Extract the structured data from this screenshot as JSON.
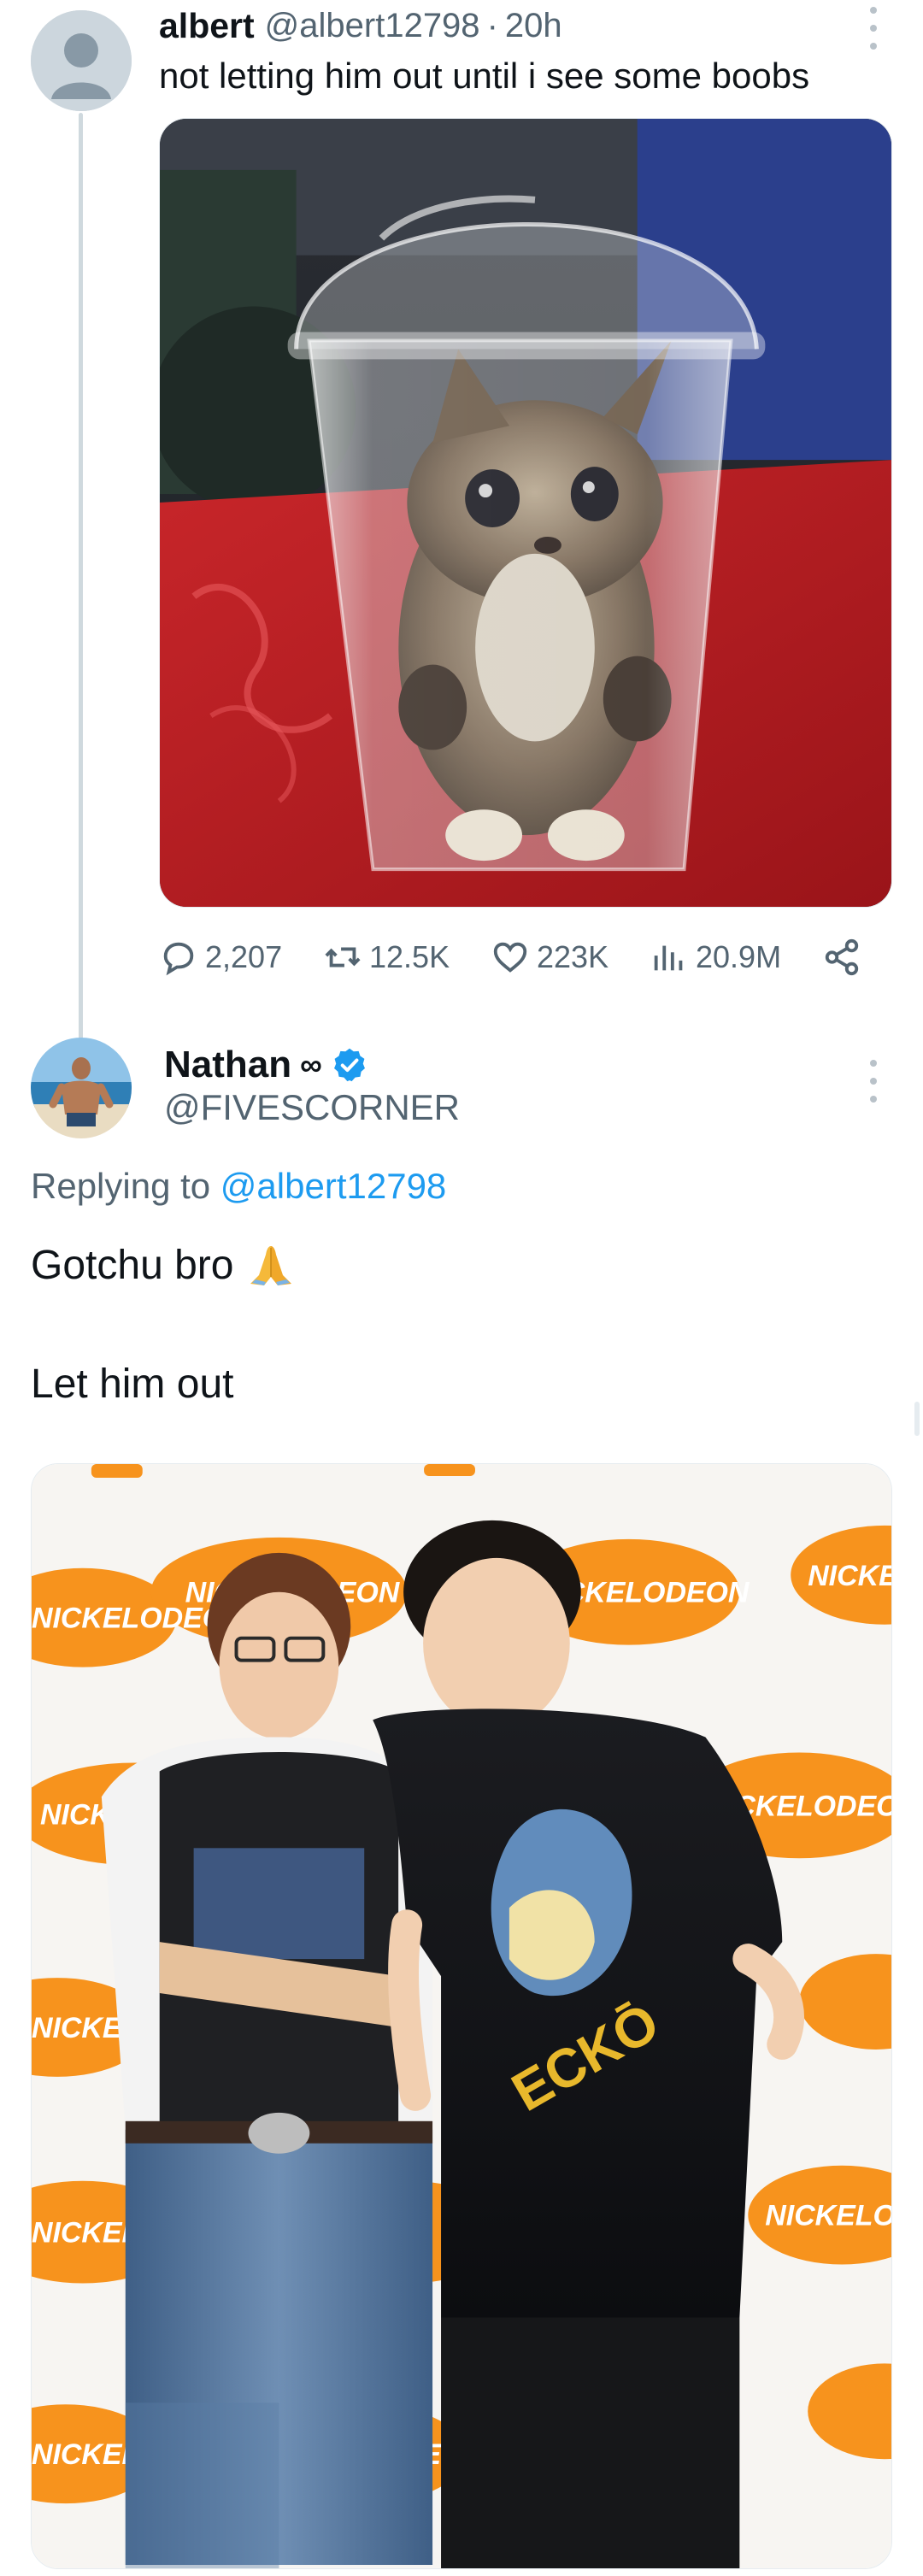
{
  "tweet1": {
    "author_name": "albert",
    "handle": "@albert12798",
    "separator": "·",
    "time": "20h",
    "text": "not letting him out until i see some boobs",
    "media": {
      "icon": "kitten-in-cup-photo"
    },
    "stats": {
      "replies": "2,207",
      "retweets": "12.5K",
      "likes": "223K",
      "views": "20.9M"
    }
  },
  "tweet2": {
    "author_name": "Nathan",
    "name_suffix": "∞",
    "handle": "@FIVESCORNER",
    "replying_prefix": "Replying to ",
    "replying_handle": "@albert12798",
    "line1": "Gotchu bro",
    "line2": "Let him out",
    "media": {
      "icon": "two-men-photo",
      "backdrop_text": "NICKELODEON"
    }
  },
  "colors": {
    "text_primary": "#0f1419",
    "text_secondary": "#536471",
    "link": "#1d9bf0",
    "verified": "#1d9bf0",
    "thread_line": "#cfd9de",
    "nick_orange": "#f7931d"
  }
}
